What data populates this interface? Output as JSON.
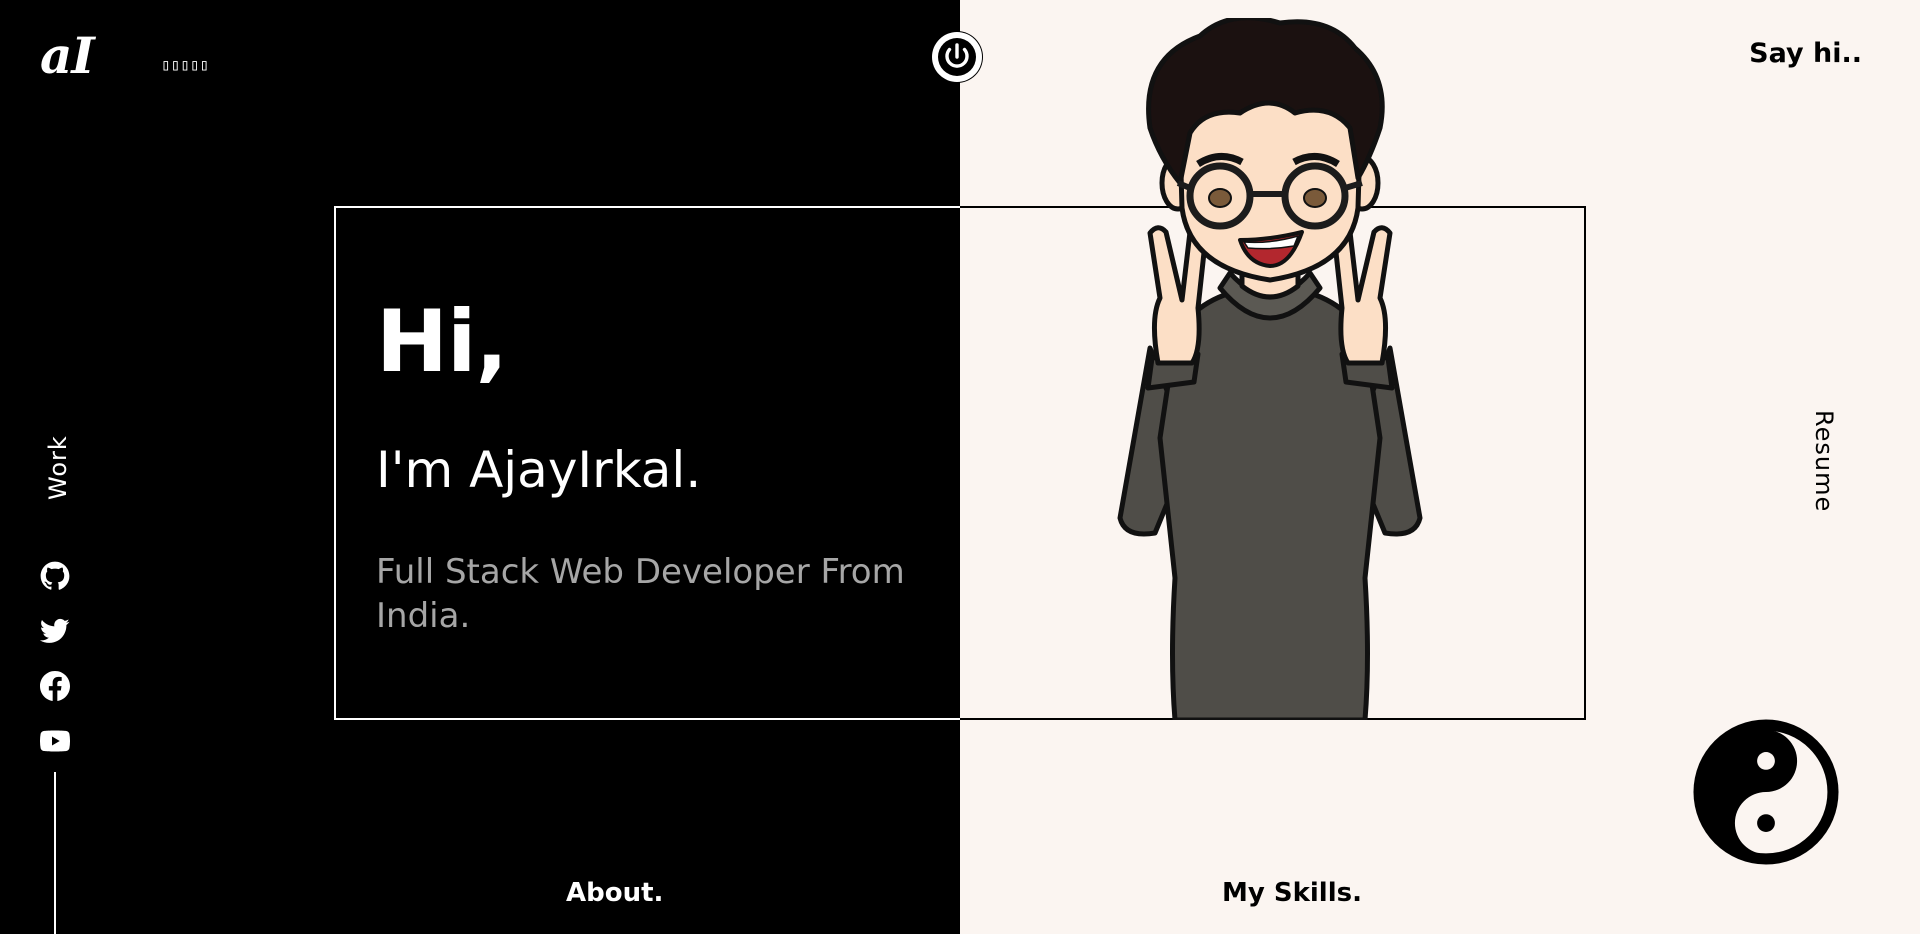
{
  "brand": {
    "logo": "aI",
    "glyph_placeholder": "▯▯▯▯▯"
  },
  "nav": {
    "say_hi": "Say hi..",
    "resume": "Resume",
    "work": "Work",
    "about": "About.",
    "skills": "My Skills."
  },
  "hero": {
    "greeting": "Hi,",
    "name": "I'm AjayIrkal.",
    "tagline": "Full Stack Web Developer From India."
  },
  "socials": [
    {
      "icon": "github-icon"
    },
    {
      "icon": "twitter-icon"
    },
    {
      "icon": "facebook-icon"
    },
    {
      "icon": "youtube-icon"
    }
  ],
  "icons": {
    "power": "power-icon",
    "theme_toggle": "yin-yang-icon"
  },
  "colors": {
    "dark_bg": "#000000",
    "light_bg": "#fbf5f1",
    "tagline_gray": "#a6a6a6",
    "skin": "#fcdfc6",
    "hoodie": "#4f4d48",
    "hair": "#1b1110"
  }
}
